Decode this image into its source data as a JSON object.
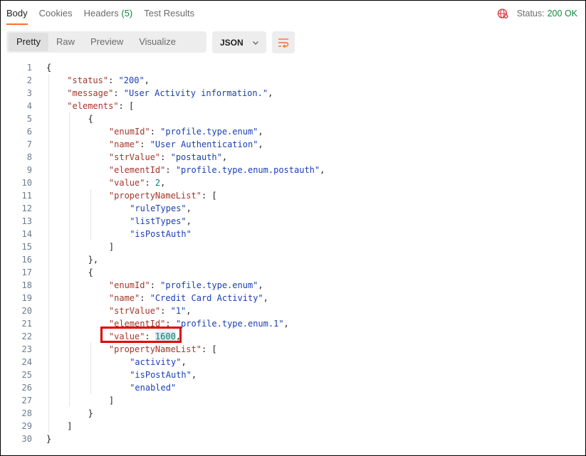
{
  "tabs": [
    {
      "label": "Body"
    },
    {
      "label": "Cookies"
    },
    {
      "label": "Headers",
      "count": "(5)"
    },
    {
      "label": "Test Results"
    }
  ],
  "status": {
    "label": "Status:",
    "value": "200 OK"
  },
  "view_modes": [
    "Pretty",
    "Raw",
    "Preview",
    "Visualize"
  ],
  "format": {
    "value": "JSON"
  },
  "code_lines": [
    [
      [
        "p",
        "{"
      ]
    ],
    [
      [
        "k",
        "\"status\""
      ],
      [
        "p",
        ": "
      ],
      [
        "s",
        "\"200\""
      ],
      [
        "p",
        ","
      ]
    ],
    [
      [
        "k",
        "\"message\""
      ],
      [
        "p",
        ": "
      ],
      [
        "s",
        "\"User Activity information.\""
      ],
      [
        "p",
        ","
      ]
    ],
    [
      [
        "k",
        "\"elements\""
      ],
      [
        "p",
        ": ["
      ]
    ],
    [
      [
        "p",
        "{"
      ]
    ],
    [
      [
        "k",
        "\"enumId\""
      ],
      [
        "p",
        ": "
      ],
      [
        "s",
        "\"profile.type.enum\""
      ],
      [
        "p",
        ","
      ]
    ],
    [
      [
        "k",
        "\"name\""
      ],
      [
        "p",
        ": "
      ],
      [
        "s",
        "\"User Authentication\""
      ],
      [
        "p",
        ","
      ]
    ],
    [
      [
        "k",
        "\"strValue\""
      ],
      [
        "p",
        ": "
      ],
      [
        "s",
        "\"postauth\""
      ],
      [
        "p",
        ","
      ]
    ],
    [
      [
        "k",
        "\"elementId\""
      ],
      [
        "p",
        ": "
      ],
      [
        "s",
        "\"profile.type.enum.postauth\""
      ],
      [
        "p",
        ","
      ]
    ],
    [
      [
        "k",
        "\"value\""
      ],
      [
        "p",
        ": "
      ],
      [
        "n",
        "2"
      ],
      [
        "p",
        ","
      ]
    ],
    [
      [
        "k",
        "\"propertyNameList\""
      ],
      [
        "p",
        ": ["
      ]
    ],
    [
      [
        "s",
        "\"ruleTypes\""
      ],
      [
        "p",
        ","
      ]
    ],
    [
      [
        "s",
        "\"listTypes\""
      ],
      [
        "p",
        ","
      ]
    ],
    [
      [
        "s",
        "\"isPostAuth\""
      ]
    ],
    [
      [
        "p",
        "]"
      ]
    ],
    [
      [
        "p",
        "},"
      ]
    ],
    [
      [
        "p",
        "{"
      ]
    ],
    [
      [
        "k",
        "\"enumId\""
      ],
      [
        "p",
        ": "
      ],
      [
        "s",
        "\"profile.type.enum\""
      ],
      [
        "p",
        ","
      ]
    ],
    [
      [
        "k",
        "\"name\""
      ],
      [
        "p",
        ": "
      ],
      [
        "s",
        "\"Credit Card Activity\""
      ],
      [
        "p",
        ","
      ]
    ],
    [
      [
        "k",
        "\"strValue\""
      ],
      [
        "p",
        ": "
      ],
      [
        "s",
        "\"1\""
      ],
      [
        "p",
        ","
      ]
    ],
    [
      [
        "k",
        "\"elementId\""
      ],
      [
        "p",
        ": "
      ],
      [
        "s",
        "\"profile.type.enum.1\""
      ],
      [
        "p",
        ","
      ]
    ],
    [
      [
        "k",
        "\"value\""
      ],
      [
        "p",
        ": "
      ],
      [
        "h",
        "1600"
      ],
      [
        "p",
        ","
      ]
    ],
    [
      [
        "k",
        "\"propertyNameList\""
      ],
      [
        "p",
        ": ["
      ]
    ],
    [
      [
        "s",
        "\"activity\""
      ],
      [
        "p",
        ","
      ]
    ],
    [
      [
        "s",
        "\"isPostAuth\""
      ],
      [
        "p",
        ","
      ]
    ],
    [
      [
        "s",
        "\"enabled\""
      ]
    ],
    [
      [
        "p",
        "]"
      ]
    ],
    [
      [
        "p",
        "}"
      ]
    ],
    [
      [
        "p",
        "]"
      ]
    ],
    [
      [
        "p",
        "}"
      ]
    ]
  ],
  "colors": {
    "accent": "#ff6c37",
    "ok": "#0f8a3c",
    "key": "#a4362a",
    "string": "#1a3fb3",
    "number": "#0f7b6c",
    "highlight_box": "#e00000"
  },
  "icons": {
    "globe": "globe-error-icon",
    "wrap": "wrap-lines-icon",
    "dropdown": "chevron-down-icon"
  }
}
